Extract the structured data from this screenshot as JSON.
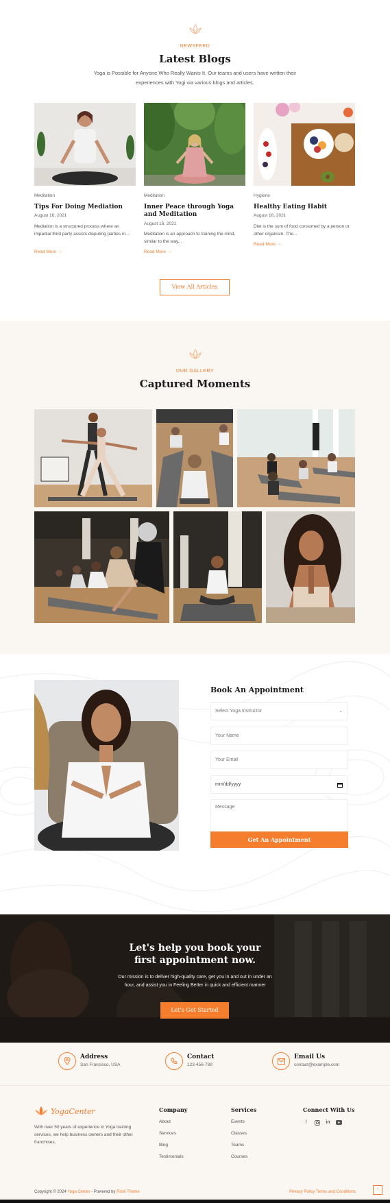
{
  "blog": {
    "eyebrow": "NEWSFEED",
    "title": "Latest Blogs",
    "description": "Yoga is Possible for Anyone Who Really Wants It. Our teams and users have written their experiences with Yogi via various blogs and articles.",
    "posts": [
      {
        "category": "Meditation",
        "title": "Tips For Doing Mediation",
        "date": "August 16, 2021",
        "excerpt": "Mediation is a structured process where an impartial third party assists disputing parties in...",
        "more": "Read More →"
      },
      {
        "category": "Meditation",
        "title": "Inner Peace through Yoga and Meditation",
        "date": "August 16, 2021",
        "excerpt": "Meditation is an approach to training the mind, similar to the way...",
        "more": "Read More →"
      },
      {
        "category": "Hygiene",
        "title": "Healthy Eating Habit",
        "date": "August 16, 2021",
        "excerpt": "Diet is the sum of food consumed by a person or other organism. The...",
        "more": "Read More →"
      }
    ],
    "view_all": "View All Articles"
  },
  "gallery": {
    "eyebrow": "OUR GALLERY",
    "title": "Captured Moments"
  },
  "appointment": {
    "title": "Book An Appointment",
    "instructor_placeholder": "Select Yoga Instructor",
    "name_placeholder": "Your Name",
    "email_placeholder": "Your Email",
    "date_placeholder": "mm/dd/yyyy",
    "message_placeholder": "Message",
    "submit": "Get An Appointment"
  },
  "cta": {
    "title": "Let's help you book your first appointment now.",
    "description": "Our mission is to deliver high-quality care, get you in and out in under an hour, and assist you in Feeling Better in quick and efficient manner",
    "button": "Let's Get Started"
  },
  "contact": {
    "address_title": "Address",
    "address_value": "San Francisco, USA",
    "phone_title": "Contact",
    "phone_value": "123-456-789",
    "email_title": "Email Us",
    "email_value": "contact@example.com"
  },
  "footer": {
    "logo": "YogaCenter",
    "description": "With over 50 years of experience in Yoga training services, we help business owners and their other franchises.",
    "company_heading": "Company",
    "company_links": [
      "About",
      "Services",
      "Blog",
      "Testimonials"
    ],
    "services_heading": "Services",
    "services_links": [
      "Events",
      "Classes",
      "Teams",
      "Courses"
    ],
    "connect_heading": "Connect With Us",
    "copyright_prefix": "Copyright © 2024",
    "copyright_brand": "Yoga Center",
    "copyright_mid": "- Powered by",
    "copyright_theme": "Rishi Theme",
    "legal": "Privacy Policy Terms and Conditions",
    "to_top": "↑"
  },
  "colors": {
    "accent": "#f57e2e",
    "cream": "#faf6f2",
    "dark": "#1b1b1b"
  }
}
